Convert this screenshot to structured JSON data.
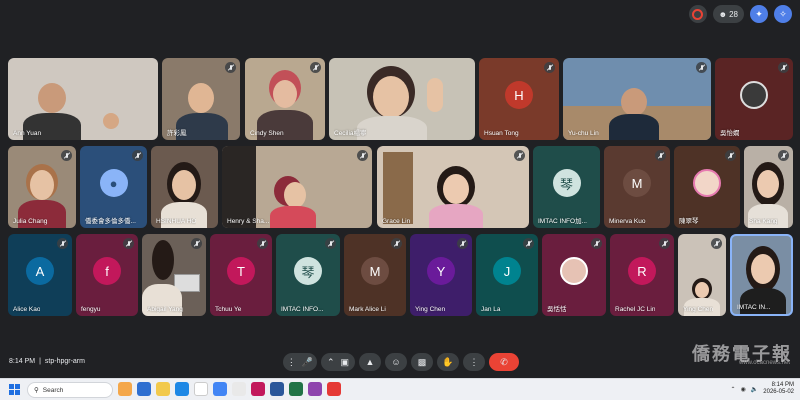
{
  "topbar": {
    "people_count": "28"
  },
  "row1": [
    {
      "name": "Ann Yuan",
      "bg": "#cfc8c0"
    },
    {
      "name": "許彩鳳",
      "bg": "#8a7a6a"
    },
    {
      "name": "Cindy Shen",
      "bg": "#b9a890"
    },
    {
      "name": "Cecilia楊寧",
      "bg": "#c7c2b6"
    },
    {
      "name": "Hsuan Tong",
      "bg": "#7a3a2a",
      "initial": "H",
      "avatar_bg": "#c0392b"
    },
    {
      "name": "Yu-chu Lin",
      "bg": "#6f8eae"
    },
    {
      "name": "吳怡嫺",
      "bg": "#5a2424"
    }
  ],
  "row2": [
    {
      "name": "Julia Chang",
      "bg": "#9a8a78"
    },
    {
      "name": "僑委會多倫多僑...",
      "bg": "#2b4f7a"
    },
    {
      "name": "HSINHUA HO",
      "bg": "#6b5a4f"
    },
    {
      "name": "Henry & Sha...",
      "bg": "#b8a894"
    },
    {
      "name": "Grace Lin",
      "bg": "#d4c6b6"
    },
    {
      "name": "IMTAC INFO加...",
      "bg": "#1f4d4a",
      "logo": "琴"
    },
    {
      "name": "Minerva Kuo",
      "bg": "#5a3a30",
      "initial": "M",
      "avatar_bg": "#6d4c41"
    },
    {
      "name": "陳翠琴",
      "bg": "#4e3226"
    },
    {
      "name": "Sha Kang",
      "bg": "#b9b0a6"
    }
  ],
  "row3": [
    {
      "name": "Alice Kao",
      "bg": "#0f3e58",
      "initial": "A",
      "avatar_bg": "#0b6aa0"
    },
    {
      "name": "fengyu",
      "bg": "#6a1e3e",
      "initial": "f",
      "avatar_bg": "#c2185b"
    },
    {
      "name": "Abigail Yang",
      "bg": "#6b6058"
    },
    {
      "name": "Tchuu Ye",
      "bg": "#6a1e3e",
      "initial": "T",
      "avatar_bg": "#c2185b"
    },
    {
      "name": "IMTAC INFO...",
      "bg": "#1f4d4a",
      "logo": "琴"
    },
    {
      "name": "Mark Alice Li",
      "bg": "#4e3226",
      "initial": "M",
      "avatar_bg": "#6d4c41"
    },
    {
      "name": "Ying Chen",
      "bg": "#3e1e6a",
      "initial": "Y",
      "avatar_bg": "#6a1b9a"
    },
    {
      "name": "Jan La",
      "bg": "#0f4e4e",
      "initial": "J",
      "avatar_bg": "#00838f"
    },
    {
      "name": "吳恬恬",
      "bg": "#6a1e3e"
    },
    {
      "name": "Rachel JC Lin",
      "bg": "#6a1e3e",
      "initial": "R",
      "avatar_bg": "#c2185b"
    },
    {
      "name": "Ying Chen",
      "bg": "#cbc2b8"
    },
    {
      "name": "IMTAC IN...",
      "bg": "#7a8ea4"
    }
  ],
  "meeting": {
    "time": "8:14 PM",
    "separator": "|",
    "code": "stp-hpgr-arm"
  },
  "watermark": {
    "main": "僑務電子報",
    "sub": "www.ocacnews.net"
  },
  "taskbar": {
    "search_placeholder": "Search",
    "clock_time": "8:14 PM",
    "clock_date": "2026-05-02"
  }
}
